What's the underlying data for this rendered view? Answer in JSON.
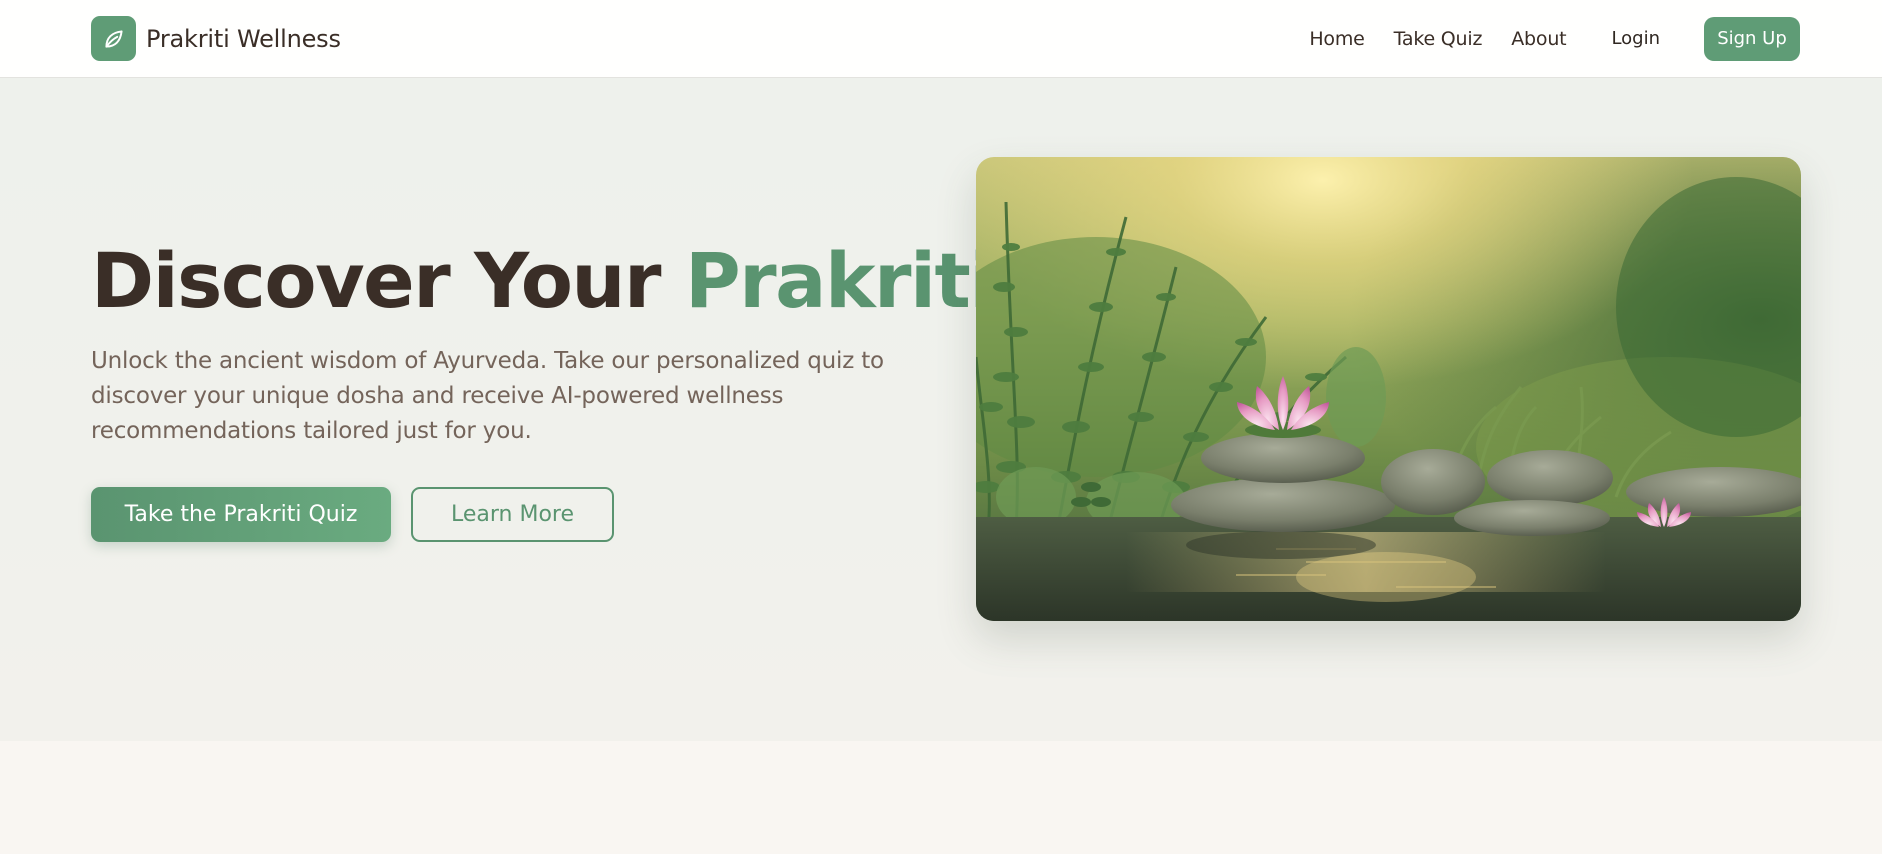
{
  "brand": {
    "name": "Prakriti Wellness",
    "logo_icon": "leaf-icon"
  },
  "nav": {
    "links": [
      "Home",
      "Take Quiz",
      "About"
    ],
    "login_label": "Login",
    "signup_label": "Sign Up"
  },
  "hero": {
    "title_main": "Discover Your ",
    "title_accent": "Prakriti",
    "description": "Unlock the ancient wisdom of Ayurveda. Take our personalized quiz to discover your unique dosha and receive AI-powered wellness recommendations tailored just for you.",
    "primary_cta": "Take the Prakriti Quiz",
    "secondary_cta": "Learn More",
    "image_subject": "lotus flower on stacked stones beside water with green herbs"
  },
  "colors": {
    "accent": "#5f9c76",
    "heading": "#3a2e27",
    "body_text": "#74645a",
    "hero_bg": "#eff1ec",
    "lower_bg": "#f9f6f2"
  }
}
